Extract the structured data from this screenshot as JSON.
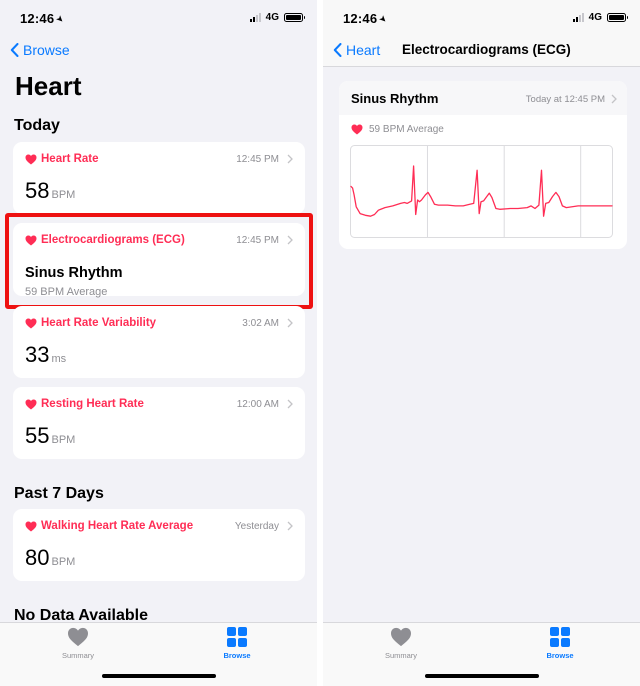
{
  "status_bar": {
    "time": "12:46",
    "network": "4G",
    "signal_bars_active": 2,
    "signal_bars_total": 4,
    "battery_level": 1.0
  },
  "colors": {
    "accent_blue": "#0a7aff",
    "heart_red": "#ff2d55",
    "highlight_red": "#ee1111",
    "secondary_gray": "#8e8e93"
  },
  "left_screen": {
    "back_label": "Browse",
    "title": "Heart",
    "sections": [
      {
        "title": "Today"
      },
      {
        "title": "Past 7 Days"
      },
      {
        "title": "No Data Available"
      }
    ],
    "cards": [
      {
        "title": "Heart Rate",
        "time": "12:45 PM",
        "value": "58",
        "unit": "BPM"
      },
      {
        "title": "Electrocardiograms (ECG)",
        "time": "12:45 PM",
        "result": "Sinus Rhythm",
        "subtitle": "59 BPM Average",
        "highlighted": true
      },
      {
        "title": "Heart Rate Variability",
        "time": "3:02 AM",
        "value": "33",
        "unit": "ms"
      },
      {
        "title": "Resting Heart Rate",
        "time": "12:00 AM",
        "value": "55",
        "unit": "BPM"
      },
      {
        "title": "Walking Heart Rate Average",
        "time": "Yesterday",
        "value": "80",
        "unit": "BPM"
      }
    ]
  },
  "right_screen": {
    "back_label": "Heart",
    "nav_title": "Electrocardiograms (ECG)",
    "ecg_card": {
      "title": "Sinus Rhythm",
      "time": "Today at 12:45 PM",
      "bpm_label": "59 BPM Average",
      "waveform": {
        "description": "ECG trace, normalized amplitude (0 = bottom, 1 = top of strip), time normalized 0-1",
        "gridlines_t": [
          0.293,
          0.587,
          0.88
        ],
        "points": [
          [
            0.0,
            0.56
          ],
          [
            0.006,
            0.54
          ],
          [
            0.012,
            0.46
          ],
          [
            0.02,
            0.32
          ],
          [
            0.035,
            0.24
          ],
          [
            0.055,
            0.22
          ],
          [
            0.075,
            0.21
          ],
          [
            0.09,
            0.23
          ],
          [
            0.105,
            0.28
          ],
          [
            0.13,
            0.31
          ],
          [
            0.16,
            0.33
          ],
          [
            0.19,
            0.36
          ],
          [
            0.205,
            0.37
          ],
          [
            0.215,
            0.36
          ],
          [
            0.232,
            0.39
          ],
          [
            0.24,
            0.8
          ],
          [
            0.248,
            0.23
          ],
          [
            0.255,
            0.4
          ],
          [
            0.262,
            0.38
          ],
          [
            0.27,
            0.4
          ],
          [
            0.285,
            0.46
          ],
          [
            0.295,
            0.49
          ],
          [
            0.305,
            0.44
          ],
          [
            0.32,
            0.35
          ],
          [
            0.335,
            0.34
          ],
          [
            0.37,
            0.34
          ],
          [
            0.4,
            0.33
          ],
          [
            0.43,
            0.33
          ],
          [
            0.455,
            0.35
          ],
          [
            0.47,
            0.36
          ],
          [
            0.483,
            0.75
          ],
          [
            0.491,
            0.24
          ],
          [
            0.498,
            0.38
          ],
          [
            0.508,
            0.39
          ],
          [
            0.52,
            0.44
          ],
          [
            0.53,
            0.48
          ],
          [
            0.54,
            0.43
          ],
          [
            0.555,
            0.3
          ],
          [
            0.57,
            0.29
          ],
          [
            0.61,
            0.3
          ],
          [
            0.64,
            0.3
          ],
          [
            0.675,
            0.31
          ],
          [
            0.69,
            0.33
          ],
          [
            0.705,
            0.3
          ],
          [
            0.72,
            0.34
          ],
          [
            0.73,
            0.75
          ],
          [
            0.738,
            0.21
          ],
          [
            0.746,
            0.36
          ],
          [
            0.758,
            0.37
          ],
          [
            0.772,
            0.44
          ],
          [
            0.785,
            0.49
          ],
          [
            0.797,
            0.44
          ],
          [
            0.81,
            0.33
          ],
          [
            0.825,
            0.31
          ],
          [
            0.87,
            0.33
          ],
          [
            0.92,
            0.33
          ],
          [
            0.96,
            0.33
          ],
          [
            1.0,
            0.33
          ]
        ]
      }
    }
  },
  "tab_bar": {
    "tabs": [
      {
        "label": "Summary",
        "icon": "heart-icon",
        "active": false
      },
      {
        "label": "Browse",
        "icon": "grid-icon",
        "active": true
      }
    ]
  }
}
